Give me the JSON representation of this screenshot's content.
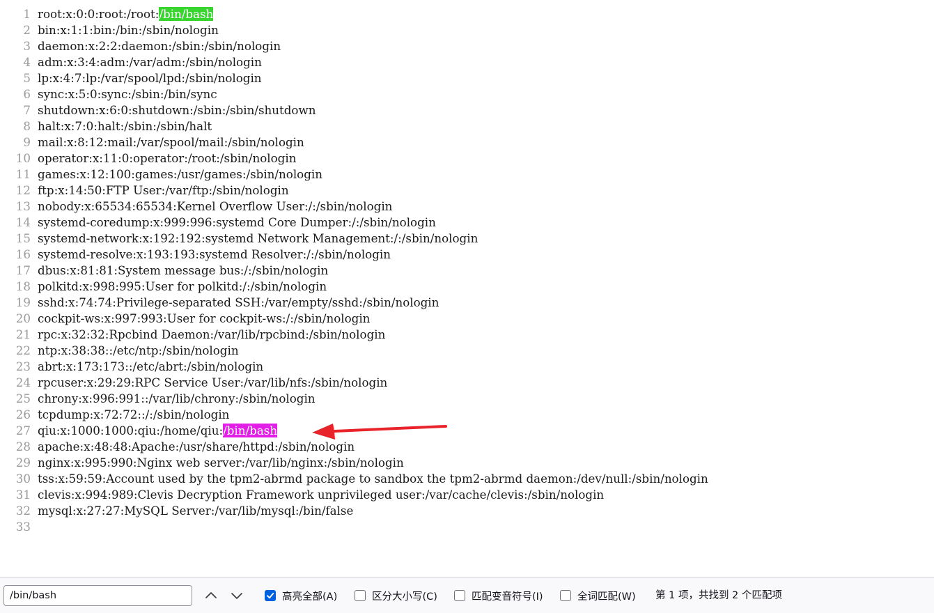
{
  "editor": {
    "lines": [
      {
        "no": "1",
        "text": "root:x:0:0:root:/root:",
        "match": "/bin/bash",
        "match_style": "green"
      },
      {
        "no": "2",
        "text": "bin:x:1:1:bin:/bin:/sbin/nologin"
      },
      {
        "no": "3",
        "text": "daemon:x:2:2:daemon:/sbin:/sbin/nologin"
      },
      {
        "no": "4",
        "text": "adm:x:3:4:adm:/var/adm:/sbin/nologin"
      },
      {
        "no": "5",
        "text": "lp:x:4:7:lp:/var/spool/lpd:/sbin/nologin"
      },
      {
        "no": "6",
        "text": "sync:x:5:0:sync:/sbin:/bin/sync"
      },
      {
        "no": "7",
        "text": "shutdown:x:6:0:shutdown:/sbin:/sbin/shutdown"
      },
      {
        "no": "8",
        "text": "halt:x:7:0:halt:/sbin:/sbin/halt"
      },
      {
        "no": "9",
        "text": "mail:x:8:12:mail:/var/spool/mail:/sbin/nologin"
      },
      {
        "no": "10",
        "text": "operator:x:11:0:operator:/root:/sbin/nologin"
      },
      {
        "no": "11",
        "text": "games:x:12:100:games:/usr/games:/sbin/nologin"
      },
      {
        "no": "12",
        "text": "ftp:x:14:50:FTP User:/var/ftp:/sbin/nologin"
      },
      {
        "no": "13",
        "text": "nobody:x:65534:65534:Kernel Overflow User:/:/sbin/nologin"
      },
      {
        "no": "14",
        "text": "systemd-coredump:x:999:996:systemd Core Dumper:/:/sbin/nologin"
      },
      {
        "no": "15",
        "text": "systemd-network:x:192:192:systemd Network Management:/:/sbin/nologin"
      },
      {
        "no": "16",
        "text": "systemd-resolve:x:193:193:systemd Resolver:/:/sbin/nologin"
      },
      {
        "no": "17",
        "text": "dbus:x:81:81:System message bus:/:/sbin/nologin"
      },
      {
        "no": "18",
        "text": "polkitd:x:998:995:User for polkitd:/:/sbin/nologin"
      },
      {
        "no": "19",
        "text": "sshd:x:74:74:Privilege-separated SSH:/var/empty/sshd:/sbin/nologin"
      },
      {
        "no": "20",
        "text": "cockpit-ws:x:997:993:User for cockpit-ws:/:/sbin/nologin"
      },
      {
        "no": "21",
        "text": "rpc:x:32:32:Rpcbind Daemon:/var/lib/rpcbind:/sbin/nologin"
      },
      {
        "no": "22",
        "text": "ntp:x:38:38::/etc/ntp:/sbin/nologin"
      },
      {
        "no": "23",
        "text": "abrt:x:173:173::/etc/abrt:/sbin/nologin"
      },
      {
        "no": "24",
        "text": "rpcuser:x:29:29:RPC Service User:/var/lib/nfs:/sbin/nologin"
      },
      {
        "no": "25",
        "text": "chrony:x:996:991::/var/lib/chrony:/sbin/nologin"
      },
      {
        "no": "26",
        "text": "tcpdump:x:72:72::/:/sbin/nologin"
      },
      {
        "no": "27",
        "text": "qiu:x:1000:1000:qiu:/home/qiu:",
        "match": "/bin/bash",
        "match_style": "magenta"
      },
      {
        "no": "28",
        "text": "apache:x:48:48:Apache:/usr/share/httpd:/sbin/nologin"
      },
      {
        "no": "29",
        "text": "nginx:x:995:990:Nginx web server:/var/lib/nginx:/sbin/nologin"
      },
      {
        "no": "30",
        "text": "tss:x:59:59:Account used by the tpm2-abrmd package to sandbox the tpm2-abrmd daemon:/dev/null:/sbin/nologin"
      },
      {
        "no": "31",
        "text": "clevis:x:994:989:Clevis Decryption Framework unprivileged user:/var/cache/clevis:/sbin/nologin"
      },
      {
        "no": "32",
        "text": "mysql:x:27:27:MySQL Server:/var/lib/mysql:/bin/false"
      },
      {
        "no": "33",
        "text": ""
      }
    ]
  },
  "annotation": {
    "color": "#e8232a",
    "icon": "red-arrow-icon"
  },
  "findbar": {
    "search_value": "/bin/bash",
    "prev_icon": "chevron-up-icon",
    "next_icon": "chevron-down-icon",
    "highlight_all": {
      "label": "高亮全部(A)",
      "checked": true
    },
    "match_case": {
      "label": "区分大小写(C)",
      "checked": false
    },
    "match_diacritics": {
      "label": "匹配变音符号(I)",
      "checked": false
    },
    "whole_words": {
      "label": "全词匹配(W)",
      "checked": false
    },
    "status": "第 1 项，共找到 2 个匹配项",
    "accent_color": "#0061e0"
  }
}
